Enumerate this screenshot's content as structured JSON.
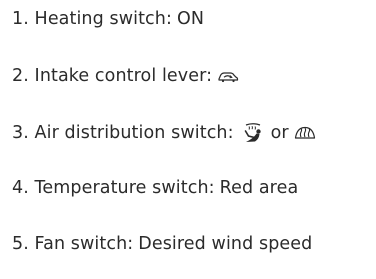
{
  "steps": [
    {
      "label": "1. Heating switch:",
      "value": "ON"
    },
    {
      "label": "2. Intake control lever:",
      "icon": "recirculation-car-icon"
    },
    {
      "label": "3. Air distribution switch:",
      "icon": "foot-defrost-icon",
      "connector": "or",
      "icon_alt": "windshield-defrost-icon"
    },
    {
      "label": "4. Temperature switch:",
      "value": "Red area"
    },
    {
      "label": "5. Fan switch:",
      "value": "Desired wind speed"
    }
  ]
}
